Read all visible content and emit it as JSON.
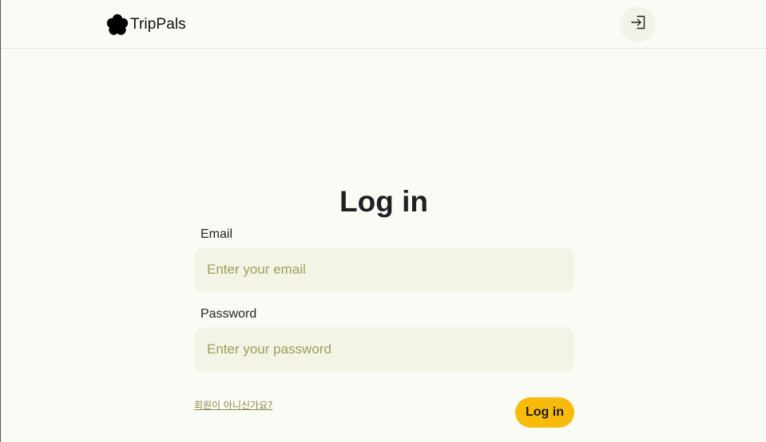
{
  "header": {
    "brand_name": "TripPals",
    "brand_logo_icon": "flower-icon",
    "login_icon": "sign-in-icon"
  },
  "login": {
    "title": "Log in",
    "email_label": "Email",
    "email_placeholder": "Enter your email",
    "email_value": "",
    "password_label": "Password",
    "password_placeholder": "Enter your password",
    "password_value": "",
    "signup_link": "회원이 아니신가요?",
    "submit_label": "Log in"
  },
  "colors": {
    "background": "#fbfbf6",
    "input_background": "#f4f4e6",
    "placeholder": "#a19b5d",
    "accent": "#f9bb0b",
    "link": "#8d8749"
  }
}
